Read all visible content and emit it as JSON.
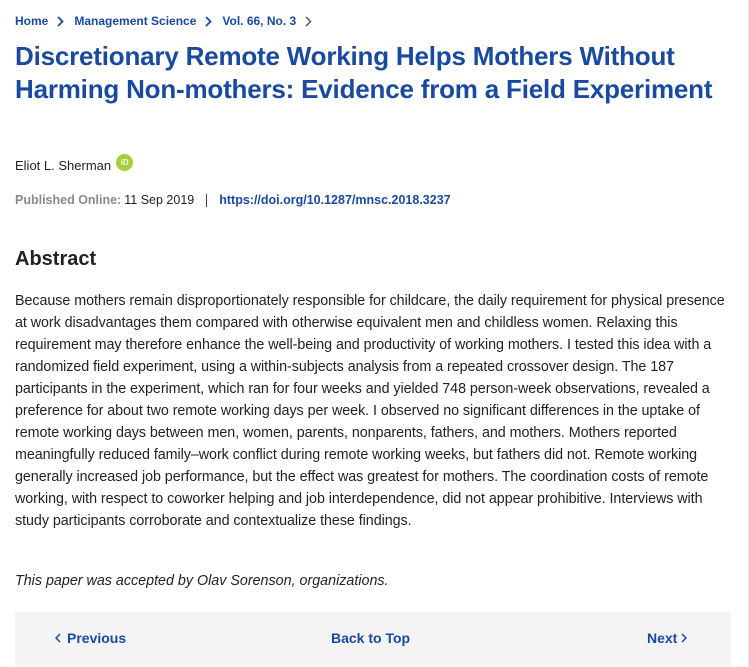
{
  "breadcrumb": {
    "items": [
      {
        "label": "Home"
      },
      {
        "label": "Management Science"
      },
      {
        "label": "Vol. 66, No. 3"
      }
    ],
    "separator_icon": "chevron-right-icon"
  },
  "article": {
    "title": "Discretionary Remote Working Helps Mothers Without Harming Non-mothers: Evidence from a Field Experiment",
    "author": "Eliot L. Sherman",
    "author_badge_icon": "orcid-icon",
    "author_badge_text": "iD",
    "published_label": "Published Online:",
    "published_date": "11 Sep 2019",
    "doi": "https://doi.org/10.1287/mnsc.2018.3237"
  },
  "abstract": {
    "heading": "Abstract",
    "body": "Because mothers remain disproportionately responsible for childcare, the daily requirement for physical presence at work disadvantages them compared with otherwise equivalent men and childless women. Relaxing this requirement may therefore enhance the well-being and productivity of working mothers. I tested this idea with a randomized field experiment, using a within-subjects analysis from a repeated crossover design. The 187 participants in the experiment, which ran for four weeks and yielded 748 person-week observations, revealed a preference for about two remote working days per week. I observed no significant differences in the uptake of remote working days between men, women, parents, nonparents, fathers, and mothers. Mothers reported meaningfully reduced family–work conflict during remote working weeks, but fathers did not. Remote working generally increased job performance, but the effect was greatest for mothers. The coordination costs of remote working, with respect to coworker helping and job interdependence, did not appear prohibitive. Interviews with study participants corroborate and contextualize these findings.",
    "accepted_note": "This paper was accepted by Olav Sorenson, organizations."
  },
  "nav": {
    "previous_label": "Previous",
    "back_to_top_label": "Back to Top",
    "next_label": "Next",
    "previous_icon": "chevron-left-icon",
    "next_icon": "chevron-right-icon"
  },
  "colors": {
    "link": "#1a4aa0",
    "text": "#222222",
    "muted": "#8a8a8a",
    "orcid": "#a6ce39",
    "nav_background": "#f4f4f4"
  }
}
